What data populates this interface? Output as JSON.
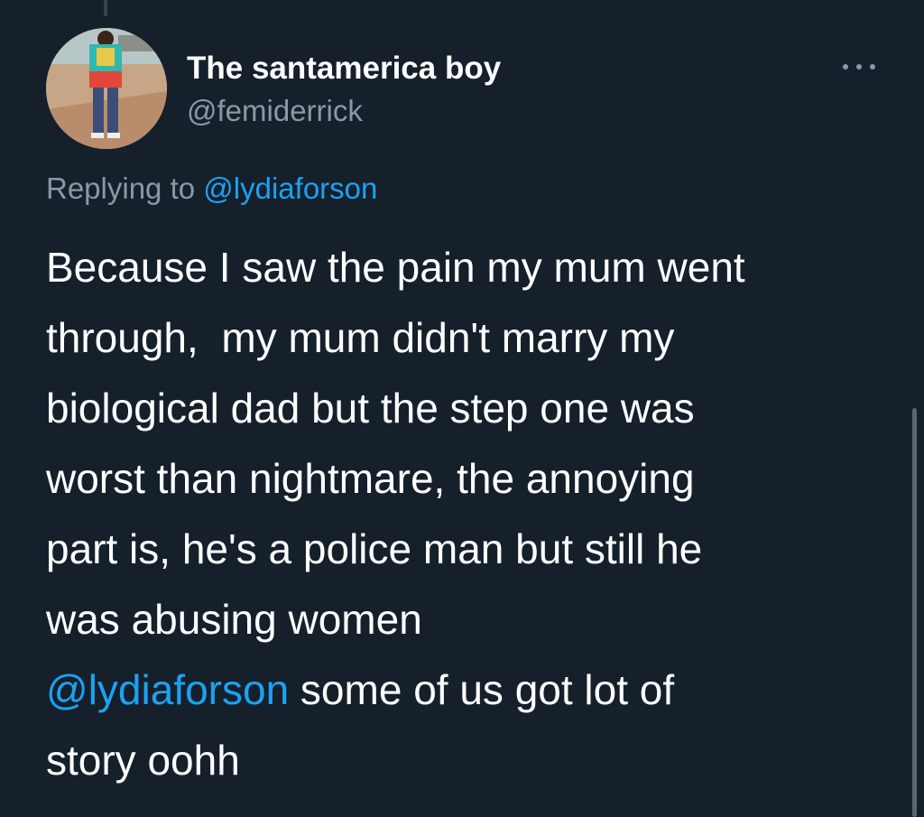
{
  "author": {
    "display_name": "The santamerica boy",
    "handle": "@femiderrick"
  },
  "reply_context": {
    "prefix": "Replying to",
    "mention": "@lydiaforson"
  },
  "tweet": {
    "lines": [
      "Because I saw the pain my mum went",
      "through,  my mum didn't marry my",
      "biological dad but the step one was",
      "worst than nightmare, the annoying",
      "part is, he's a police man but still he",
      "was abusing women"
    ],
    "mention": "@lydiaforson",
    "mention_line_rest": " some of us got lot of",
    "last_line": "story oohh"
  },
  "icons": {
    "more": "more-options-icon",
    "avatar": "profile-photo"
  },
  "colors": {
    "background": "#15202b",
    "text": "#ffffff",
    "secondary_text": "#8899a6",
    "link": "#1da1f2"
  }
}
